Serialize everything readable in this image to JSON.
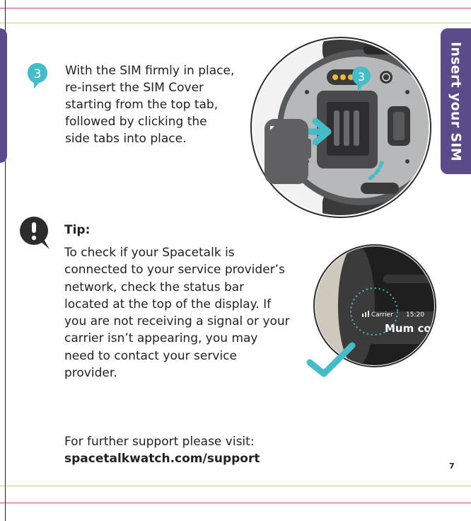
{
  "side_tab": {
    "label": "Insert your SIM"
  },
  "step": {
    "number": "3",
    "text": "With the SIM firmly in place, re-insert the SIM Cover starting from the top tab, followed by clicking the side tabs into place."
  },
  "tip": {
    "title": "Tip:",
    "body": "To check if your Spacetalk is connected to your service provider’s network, check the status bar located at the top of the display. If you are not receiving a signal or your carrier isn’t appearing, you may need to contact your service provider."
  },
  "support": {
    "text": "For further support please visit:",
    "url": "spacetalkwatch.com/support"
  },
  "illustration_watch_back": {
    "step_badge": "3"
  },
  "illustration_display": {
    "carrier": "Carrier",
    "time": "15:20",
    "contact_name": "Mum co"
  },
  "page_number": "7",
  "colors": {
    "accent_purple": "#5b4b8a",
    "accent_teal": "#46bcc8",
    "pin_gold": "#f0b43a",
    "trim_magenta": "#d63a8f",
    "trim_green": "#b9d978"
  }
}
